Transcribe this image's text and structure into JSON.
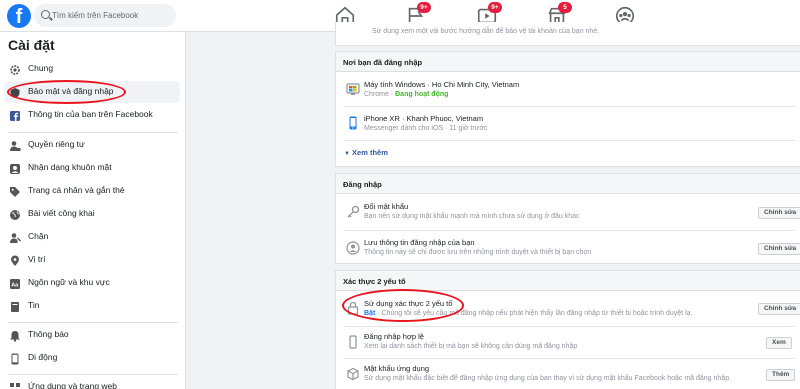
{
  "header": {
    "search_placeholder": "Tìm kiếm trên Facebook",
    "badges": {
      "flag": "9+",
      "video": "9+",
      "market": "5"
    }
  },
  "sidebar": {
    "title": "Cài đặt",
    "items": [
      {
        "label": "Chung",
        "icon": "gear-icon"
      },
      {
        "label": "Bảo mật và đăng nhập",
        "icon": "shield-icon"
      },
      {
        "label": "Thông tin của bạn trên Facebook",
        "icon": "facebook-square-icon"
      },
      {
        "label": "Quyền riêng tư",
        "icon": "lock-person-icon"
      },
      {
        "label": "Nhận dạng khuôn mặt",
        "icon": "face-icon"
      },
      {
        "label": "Trang cá nhân và gắn thẻ",
        "icon": "tag-icon"
      },
      {
        "label": "Bài viết công khai",
        "icon": "globe-icon"
      },
      {
        "label": "Chặn",
        "icon": "block-user-icon"
      },
      {
        "label": "Vị trí",
        "icon": "location-pin-icon"
      },
      {
        "label": "Ngôn ngữ và khu vực",
        "icon": "language-icon"
      },
      {
        "label": "Tin",
        "icon": "book-icon"
      },
      {
        "label": "Thông báo",
        "icon": "bell-icon"
      },
      {
        "label": "Di động",
        "icon": "mobile-icon"
      },
      {
        "label": "Ứng dụng và trang web",
        "icon": "apps-icon"
      }
    ]
  },
  "main": {
    "top_text": "Sử dụng xem một vài bước hướng dẫn để bảo vệ tài khoản của bạn nhé.",
    "where_logged_in": {
      "title": "Nơi bạn đã đăng nhập",
      "devices": [
        {
          "title": "Máy tính Windows · Ho Chi Minh City, Vietnam",
          "sub_prefix": "Chrome · ",
          "sub_status": "Đang hoạt động"
        },
        {
          "title": "iPhone XR · Khanh Phuoc, Vietnam",
          "sub": "Messenger dành cho iOS · 11 giờ trước"
        }
      ],
      "see_more": "Xem thêm"
    },
    "login": {
      "title": "Đăng nhập",
      "rows": [
        {
          "title": "Đổi mật khẩu",
          "sub": "Bạn nên sử dụng mật khẩu mạnh mà mình chưa sử dụng ở đâu khác",
          "button": "Chỉnh sửa"
        },
        {
          "title": "Lưu thông tin đăng nhập của bạn",
          "sub": "Thông tin này sẽ chỉ được lưu trên những trình duyệt và thiết bị bạn chọn",
          "button": "Chỉnh sửa"
        }
      ]
    },
    "two_factor": {
      "title": "Xác thực 2 yếu tố",
      "rows": [
        {
          "title": "Sử dụng xác thực 2 yếu tố",
          "sub_status": "Bật",
          "sub": " · Chúng tôi sẽ yêu cầu mã đăng nhập nếu phát hiện thấy lần đăng nhập từ thiết bị hoặc trình duyệt lạ.",
          "button": "Chỉnh sửa"
        },
        {
          "title": "Đăng nhập hợp lệ",
          "sub": "Xem lại danh sách thiết bị mà bạn sẽ không cần dùng mã đăng nhập",
          "button": "Xem"
        },
        {
          "title": "Mật khẩu ứng dụng",
          "sub": "Sử dụng mật khẩu đặc biệt để đăng nhập ứng dụng của bạn thay vì sử dụng mật khẩu Facebook hoặc mã đăng nhập.",
          "button": "Thêm"
        }
      ]
    }
  },
  "colors": {
    "brand": "#1877f2",
    "highlight": "#e8141e",
    "active_green": "#42b72a"
  }
}
